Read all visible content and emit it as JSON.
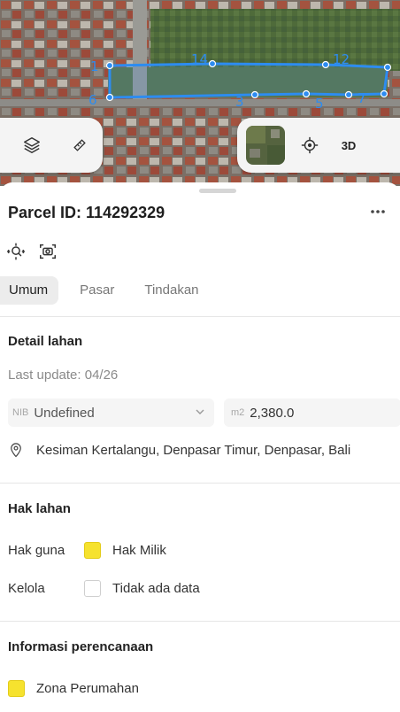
{
  "map": {
    "vertex_labels": [
      "14",
      "12",
      "1",
      "3",
      "5",
      "7",
      "6"
    ],
    "controls": {
      "layers_icon": "layers-icon",
      "draw_icon": "ruler-icon",
      "locate_icon": "crosshair-icon",
      "mode_3d_label": "3D"
    },
    "parcel_color": "#2d8cf0"
  },
  "parcel": {
    "title": "Parcel ID: 114292329",
    "more_label": "•••"
  },
  "tabs": [
    {
      "label": "Umum",
      "active": true
    },
    {
      "label": "Pasar",
      "active": false
    },
    {
      "label": "Tindakan",
      "active": false
    }
  ],
  "detail": {
    "section_title": "Detail lahan",
    "last_update": "Last update: 04/26",
    "nib_label": "NIB",
    "nib_value": "Undefined",
    "area_unit": "m2",
    "area_value": "2,380.0",
    "address": "Kesiman Kertalangu, Denpasar Timur, Denpasar, Bali"
  },
  "rights": {
    "section_title": "Hak lahan",
    "rows": [
      {
        "key": "Hak guna",
        "value": "Hak Milik",
        "color": "#f6e22e"
      },
      {
        "key": "Kelola",
        "value": "Tidak ada data",
        "color": "#ffffff"
      }
    ]
  },
  "planning": {
    "section_title": "Informasi perencanaan",
    "zone": "Zona Perumahan",
    "zone_color": "#f6e22e"
  }
}
